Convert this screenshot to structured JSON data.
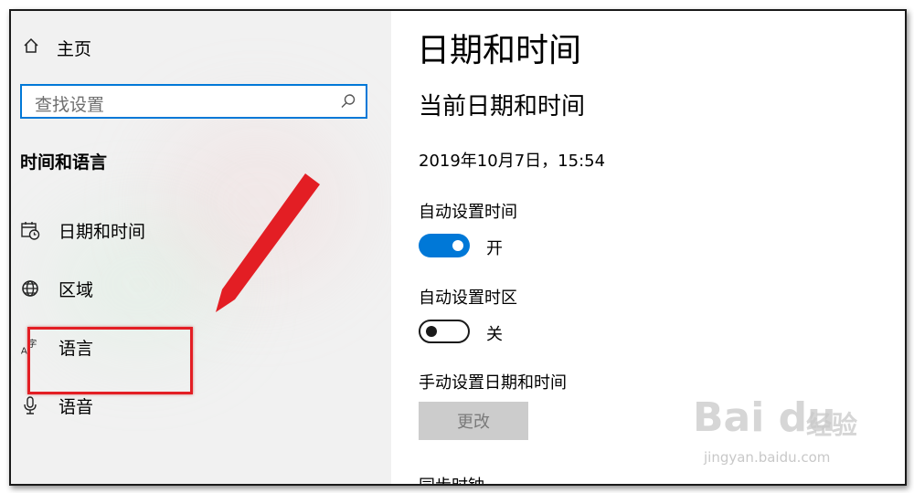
{
  "sidebar": {
    "home_label": "主页",
    "search_placeholder": "查找设置",
    "section_title": "时间和语言",
    "items": [
      {
        "label": "日期和时间",
        "icon": "calendar-clock-icon"
      },
      {
        "label": "区域",
        "icon": "globe-icon"
      },
      {
        "label": "语言",
        "icon": "language-icon"
      },
      {
        "label": "语音",
        "icon": "microphone-icon"
      }
    ]
  },
  "main": {
    "page_title": "日期和时间",
    "section_title": "当前日期和时间",
    "current_datetime": "2019年10月7日，15:54",
    "auto_time": {
      "label": "自动设置时间",
      "state": "开",
      "on": true
    },
    "auto_timezone": {
      "label": "自动设置时区",
      "state": "关",
      "on": false
    },
    "manual": {
      "label": "手动设置日期和时间",
      "button": "更改"
    },
    "cutoff_label": "同步时钟"
  },
  "annotation": {
    "color": "#e31e24"
  },
  "watermark": {
    "logo": "Bai du",
    "cn": "经验",
    "url": "jingyan.baidu.com"
  },
  "colors": {
    "accent": "#0078d7",
    "sidebar_bg": "#f1f1f1",
    "button_bg": "#cccccc"
  }
}
